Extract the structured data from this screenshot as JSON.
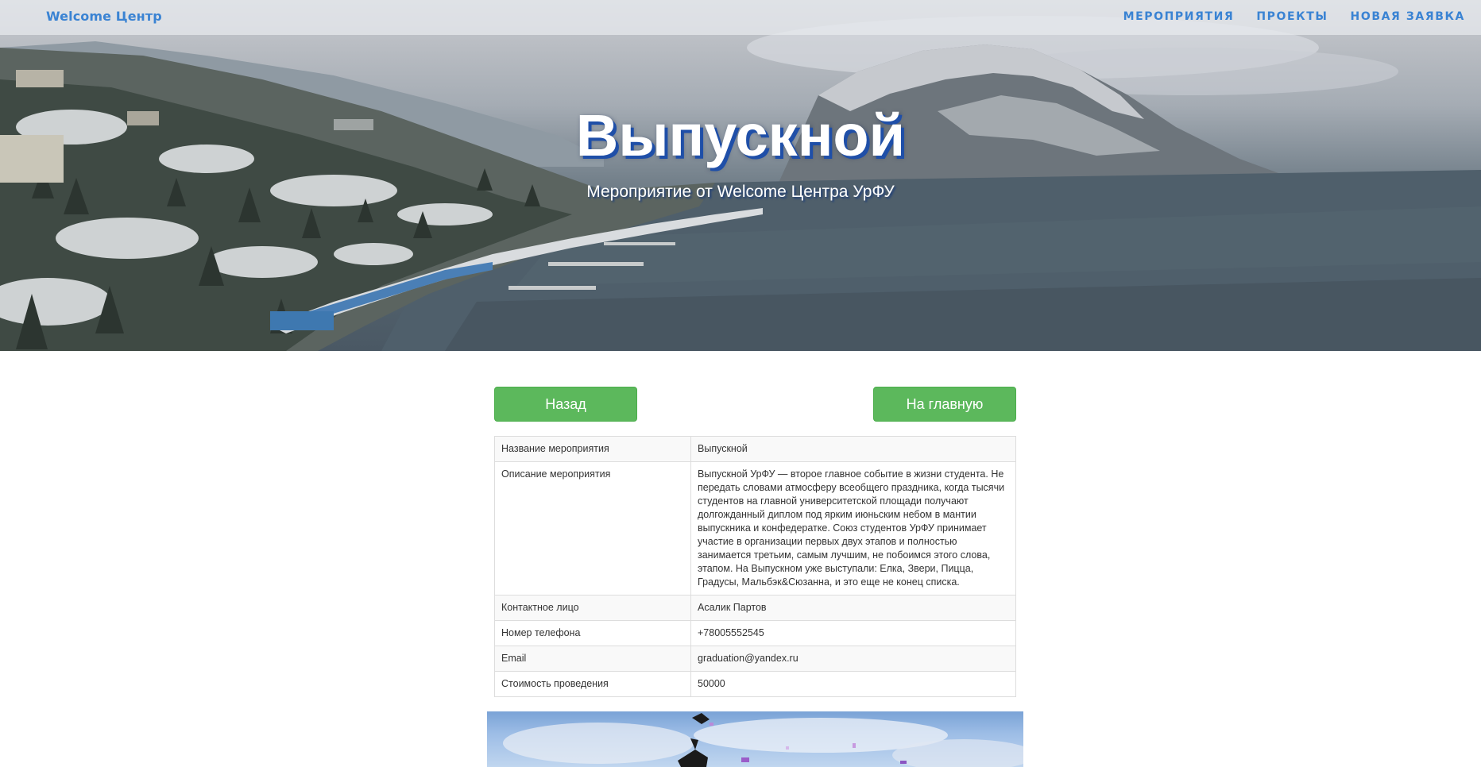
{
  "navbar": {
    "brand": "Welcome Центр",
    "links": [
      "МЕРОПРИЯТИЯ",
      "ПРОЕКТЫ",
      "НОВАЯ ЗАЯВКА"
    ]
  },
  "hero": {
    "title": "Выпускной",
    "subtitle": "Мероприятие от Welcome Центра УрФУ"
  },
  "buttons": {
    "back": "Назад",
    "home": "На главную"
  },
  "event": {
    "rows": [
      {
        "label": "Название мероприятия",
        "value": "Выпускной"
      },
      {
        "label": "Описание мероприятия",
        "value": "Выпускной УрФУ — второе главное событие в жизни студента. Не передать словами атмосферу всеобщего праздника, когда тысячи студентов на главной университетской площади получают долгожданный диплом под ярким июньским небом в мантии выпускника и конфедератке. Союз студентов УрФУ принимает участие в организации первых двух этапов и полностью занимается третьим, самым лучшим, не побоимся этого слова, этапом. На Выпускном уже выступали: Елка, Звери, Пицца, Градусы, Мальбэк&Сюзанна, и это еще не конец списка."
      },
      {
        "label": "Контактное лицо",
        "value": "Асалик Партов"
      },
      {
        "label": "Номер телефона",
        "value": "+78005552545"
      },
      {
        "label": "Email",
        "value": "graduation@yandex.ru"
      },
      {
        "label": "Стоимость проведения",
        "value": "50000"
      }
    ]
  },
  "icons": [
    "hero-landscape-image",
    "graduation-photo"
  ],
  "colors": {
    "accent": "#3a83d3",
    "button": "#5cb85c",
    "title_shadow": "#1f4fa8"
  }
}
